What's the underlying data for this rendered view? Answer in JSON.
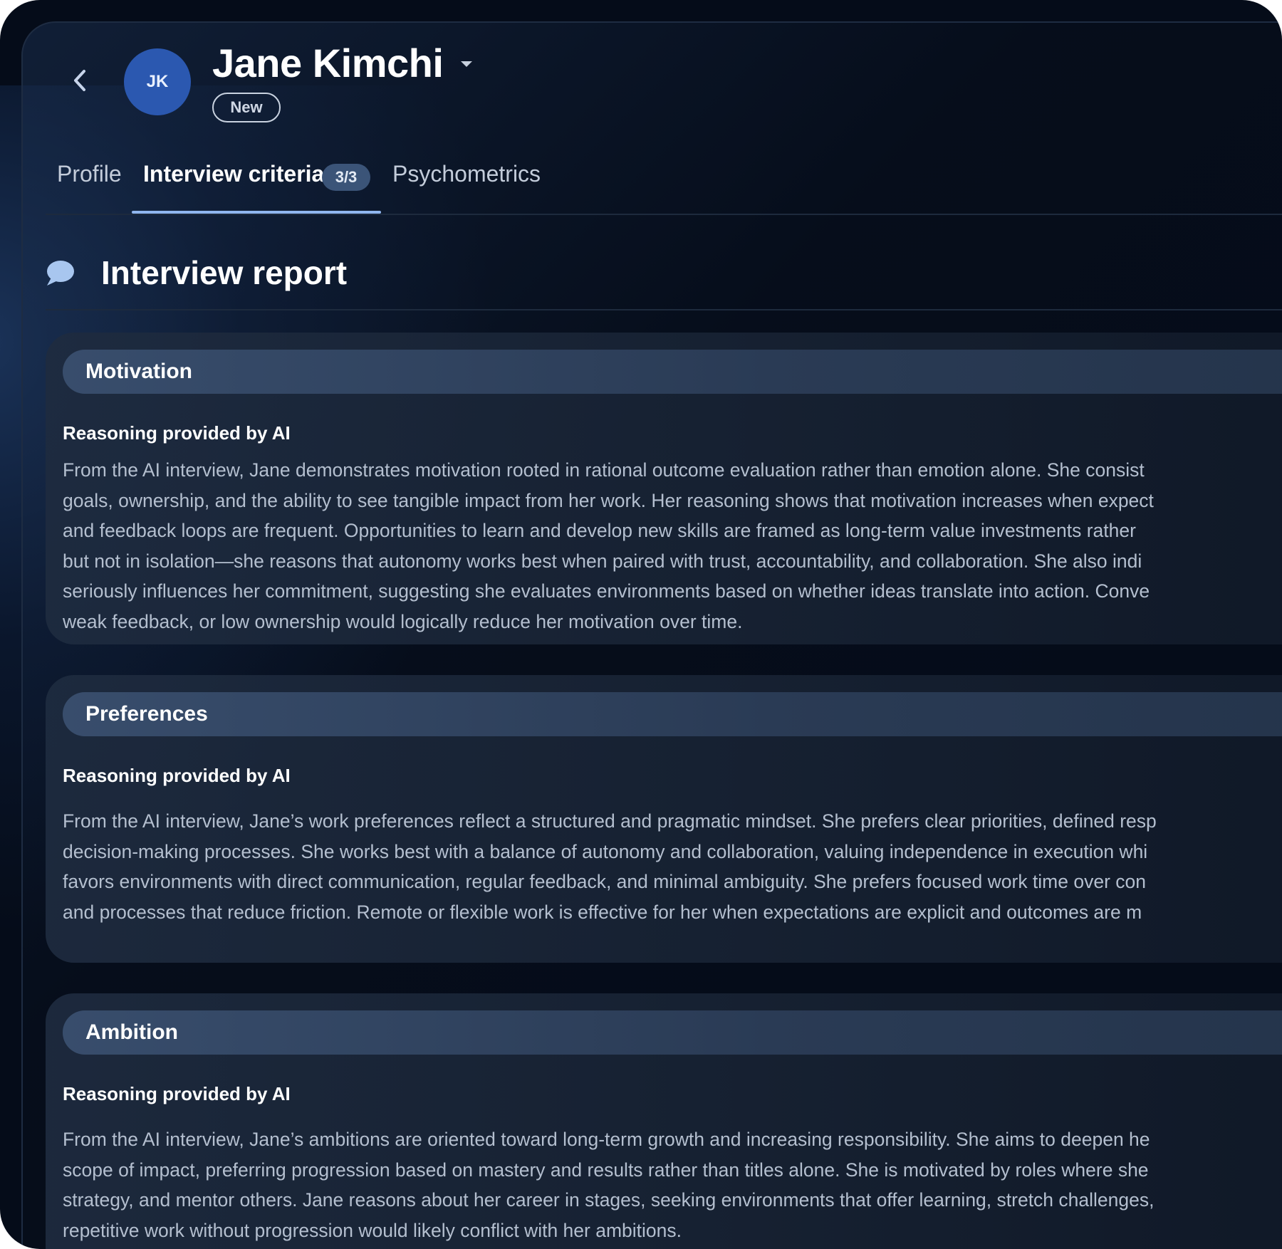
{
  "header": {
    "initials": "JK",
    "name": "Jane Kimchi",
    "status": "New"
  },
  "tabs": [
    {
      "label": "Profile"
    },
    {
      "label": "Interview criteria",
      "count": "3/3"
    },
    {
      "label": "Psychometrics"
    }
  ],
  "report": {
    "title": "Interview report"
  },
  "sections": [
    {
      "title": "Motivation",
      "reason_label": "Reasoning provided by AI",
      "lines": [
        "From the AI interview, Jane demonstrates motivation rooted in rational outcome evaluation rather than emotion alone. She consist",
        "goals, ownership, and the ability to see tangible impact from her work. Her reasoning shows that motivation increases when expect",
        "and feedback loops are frequent. Opportunities to learn and develop new skills are framed as long-term value investments rather",
        "but not in isolation—she reasons that autonomy works best when paired with trust, accountability, and collaboration. She also indi",
        "seriously influences her commitment, suggesting she evaluates environments based on whether ideas translate into action. Conve",
        "weak feedback, or low ownership would logically reduce her motivation over time."
      ]
    },
    {
      "title": "Preferences",
      "reason_label": "Reasoning provided by AI",
      "lines": [
        "From the AI interview, Jane’s work preferences reflect a structured and pragmatic mindset. She prefers clear priorities, defined resp",
        "decision-making processes. She works best with a balance of autonomy and collaboration, valuing independence in execution whi",
        "favors environments with direct communication, regular feedback, and minimal ambiguity. She prefers focused work time over con",
        "and processes that reduce friction. Remote or flexible work is effective for her when expectations are explicit and outcomes are m"
      ]
    },
    {
      "title": "Ambition",
      "reason_label": "Reasoning provided by AI",
      "lines": [
        "From the AI interview, Jane’s ambitions are oriented toward long-term growth and increasing responsibility. She aims to deepen he",
        "scope of impact, preferring progression based on mastery and results rather than titles alone. She is motivated by roles where she",
        "strategy, and mentor others. Jane reasons about her career in stages, seeking environments that offer learning, stretch challenges,",
        "repetitive work without progression would likely conflict with her ambitions."
      ]
    }
  ],
  "icons": {
    "back": "chevron-left-icon",
    "caret": "caret-down-icon",
    "report": "chat-bubble-icon"
  },
  "colors": {
    "background": "#050c19",
    "avatar": "#2b58b0",
    "tab_indicator": "#8fb6ef",
    "badge": "#3b5478"
  }
}
